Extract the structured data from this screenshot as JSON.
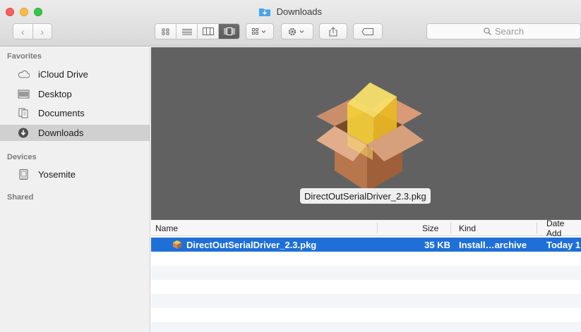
{
  "window": {
    "title": "Downloads"
  },
  "toolbar": {
    "back_icon": "chevron-left-icon",
    "forward_icon": "chevron-right-icon",
    "view_modes": [
      "icon-view-icon",
      "list-view-icon",
      "column-view-icon",
      "coverflow-view-icon"
    ],
    "active_view": "coverflow-view-icon",
    "search_placeholder": "Search"
  },
  "sidebar": {
    "sections": [
      {
        "title": "Favorites"
      },
      {
        "title": "Devices"
      },
      {
        "title": "Shared"
      }
    ],
    "favorites": [
      {
        "label": "iCloud Drive",
        "icon": "cloud-icon"
      },
      {
        "label": "Desktop",
        "icon": "desktop-icon"
      },
      {
        "label": "Documents",
        "icon": "documents-icon"
      },
      {
        "label": "Downloads",
        "icon": "downloads-icon",
        "selected": true
      }
    ],
    "devices": [
      {
        "label": "Yosemite",
        "icon": "disk-icon"
      }
    ]
  },
  "preview": {
    "caption": "DirectOutSerialDriver_2.3.pkg"
  },
  "list": {
    "columns": [
      "Name",
      "Size",
      "Kind",
      "Date Add"
    ],
    "rows": [
      {
        "name": "DirectOutSerialDriver_2.3.pkg",
        "size": "35 KB",
        "kind": "Install…archive",
        "date": "Today 1"
      }
    ]
  },
  "colors": {
    "selection": "#1f6fd8",
    "preview_background": "#616161",
    "sidebar_background": "#f0f0f0"
  }
}
